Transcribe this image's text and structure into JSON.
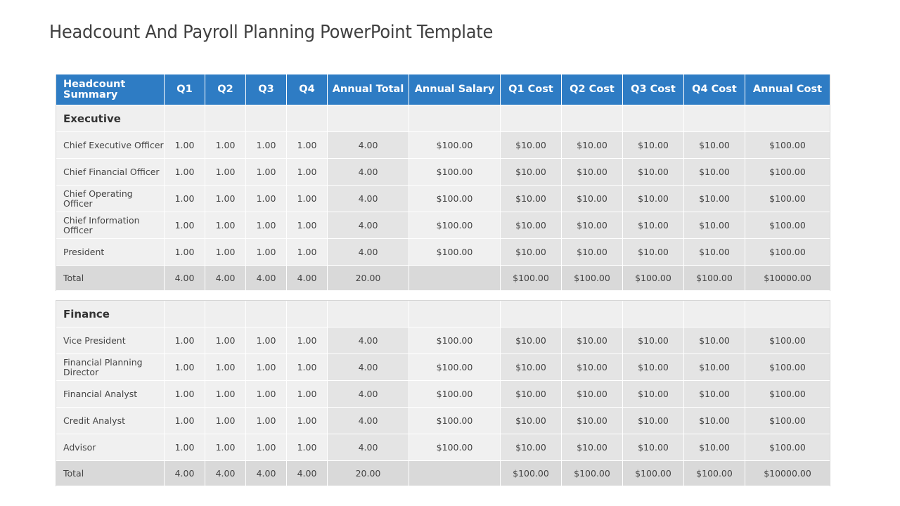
{
  "slide": {
    "title": "Headcount And Payroll Planning PowerPoint Template"
  },
  "header": {
    "columns": [
      "Headcount Summary",
      "Q1",
      "Q2",
      "Q3",
      "Q4",
      "Annual Total",
      "Annual Salary",
      "Q1 Cost",
      "Q2 Cost",
      "Q3 Cost",
      "Q4 Cost",
      "Annual Cost"
    ],
    "accent_color": "#2e7cc4"
  },
  "sections": [
    {
      "name": "Executive",
      "rows": [
        {
          "role": "Chief Executive Officer",
          "q1": "1.00",
          "q2": "1.00",
          "q3": "1.00",
          "q4": "1.00",
          "annual_total": "4.00",
          "annual_salary": "$100.00",
          "q1_cost": "$10.00",
          "q2_cost": "$10.00",
          "q3_cost": "$10.00",
          "q4_cost": "$10.00",
          "annual_cost": "$100.00"
        },
        {
          "role": "Chief Financial Officer",
          "q1": "1.00",
          "q2": "1.00",
          "q3": "1.00",
          "q4": "1.00",
          "annual_total": "4.00",
          "annual_salary": "$100.00",
          "q1_cost": "$10.00",
          "q2_cost": "$10.00",
          "q3_cost": "$10.00",
          "q4_cost": "$10.00",
          "annual_cost": "$100.00"
        },
        {
          "role": "Chief Operating Officer",
          "q1": "1.00",
          "q2": "1.00",
          "q3": "1.00",
          "q4": "1.00",
          "annual_total": "4.00",
          "annual_salary": "$100.00",
          "q1_cost": "$10.00",
          "q2_cost": "$10.00",
          "q3_cost": "$10.00",
          "q4_cost": "$10.00",
          "annual_cost": "$100.00"
        },
        {
          "role": "Chief Information Officer",
          "q1": "1.00",
          "q2": "1.00",
          "q3": "1.00",
          "q4": "1.00",
          "annual_total": "4.00",
          "annual_salary": "$100.00",
          "q1_cost": "$10.00",
          "q2_cost": "$10.00",
          "q3_cost": "$10.00",
          "q4_cost": "$10.00",
          "annual_cost": "$100.00"
        },
        {
          "role": "President",
          "q1": "1.00",
          "q2": "1.00",
          "q3": "1.00",
          "q4": "1.00",
          "annual_total": "4.00",
          "annual_salary": "$100.00",
          "q1_cost": "$10.00",
          "q2_cost": "$10.00",
          "q3_cost": "$10.00",
          "q4_cost": "$10.00",
          "annual_cost": "$100.00"
        }
      ],
      "total": {
        "label": "Total",
        "q1": "4.00",
        "q2": "4.00",
        "q3": "4.00",
        "q4": "4.00",
        "annual_total": "20.00",
        "annual_salary": "",
        "q1_cost": "$100.00",
        "q2_cost": "$100.00",
        "q3_cost": "$100.00",
        "q4_cost": "$100.00",
        "annual_cost": "$10000.00"
      }
    },
    {
      "name": "Finance",
      "rows": [
        {
          "role": "Vice President",
          "q1": "1.00",
          "q2": "1.00",
          "q3": "1.00",
          "q4": "1.00",
          "annual_total": "4.00",
          "annual_salary": "$100.00",
          "q1_cost": "$10.00",
          "q2_cost": "$10.00",
          "q3_cost": "$10.00",
          "q4_cost": "$10.00",
          "annual_cost": "$100.00"
        },
        {
          "role": "Financial Planning Director",
          "q1": "1.00",
          "q2": "1.00",
          "q3": "1.00",
          "q4": "1.00",
          "annual_total": "4.00",
          "annual_salary": "$100.00",
          "q1_cost": "$10.00",
          "q2_cost": "$10.00",
          "q3_cost": "$10.00",
          "q4_cost": "$10.00",
          "annual_cost": "$100.00"
        },
        {
          "role": "Financial Analyst",
          "q1": "1.00",
          "q2": "1.00",
          "q3": "1.00",
          "q4": "1.00",
          "annual_total": "4.00",
          "annual_salary": "$100.00",
          "q1_cost": "$10.00",
          "q2_cost": "$10.00",
          "q3_cost": "$10.00",
          "q4_cost": "$10.00",
          "annual_cost": "$100.00"
        },
        {
          "role": "Credit Analyst",
          "q1": "1.00",
          "q2": "1.00",
          "q3": "1.00",
          "q4": "1.00",
          "annual_total": "4.00",
          "annual_salary": "$100.00",
          "q1_cost": "$10.00",
          "q2_cost": "$10.00",
          "q3_cost": "$10.00",
          "q4_cost": "$10.00",
          "annual_cost": "$100.00"
        },
        {
          "role": "Advisor",
          "q1": "1.00",
          "q2": "1.00",
          "q3": "1.00",
          "q4": "1.00",
          "annual_total": "4.00",
          "annual_salary": "$100.00",
          "q1_cost": "$10.00",
          "q2_cost": "$10.00",
          "q3_cost": "$10.00",
          "q4_cost": "$10.00",
          "annual_cost": "$100.00"
        }
      ],
      "total": {
        "label": "Total",
        "q1": "4.00",
        "q2": "4.00",
        "q3": "4.00",
        "q4": "4.00",
        "annual_total": "20.00",
        "annual_salary": "",
        "q1_cost": "$100.00",
        "q2_cost": "$100.00",
        "q3_cost": "$100.00",
        "q4_cost": "$100.00",
        "annual_cost": "$10000.00"
      }
    }
  ]
}
